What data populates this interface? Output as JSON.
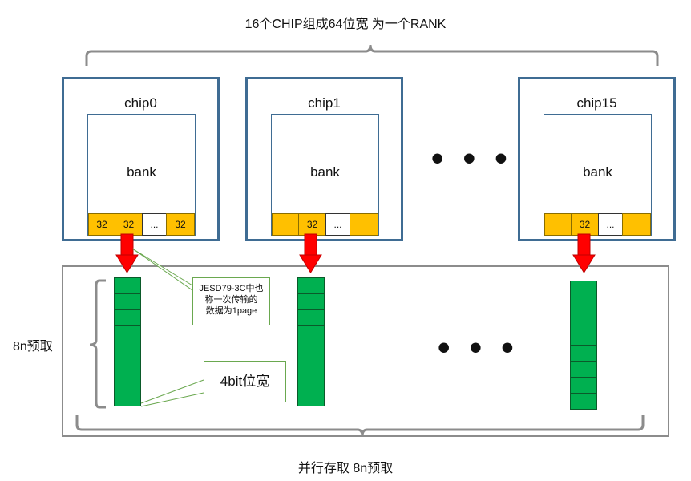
{
  "top_label": "16个CHIP组成64位宽 为一个RANK",
  "bottom_label": "并行存取 8n预取",
  "side_label": "8n预取",
  "chips": [
    {
      "name": "chip0",
      "bank": "bank",
      "cells": [
        "32",
        "32",
        "...",
        "32"
      ]
    },
    {
      "name": "chip1",
      "bank": "bank",
      "cells": [
        "",
        "32",
        "...",
        ""
      ]
    },
    {
      "name": "chip15",
      "bank": "bank",
      "cells": [
        "",
        "32",
        "...",
        ""
      ]
    }
  ],
  "ellipsis": "• • •",
  "callout_page": {
    "line1": "JESD79-3C中也",
    "line2": "称一次传输的",
    "line3": "数据为1page"
  },
  "callout_width": "4bit位宽",
  "colors": {
    "chip_border": "#3f6c93",
    "cell": "#ffc000",
    "stack": "#00b050",
    "arrow": "#ff0000",
    "brace": "#8c8c8c"
  },
  "stack_segments": 8
}
